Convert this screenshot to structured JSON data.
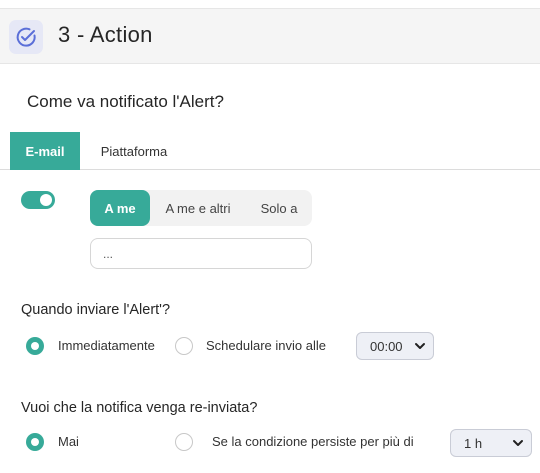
{
  "header": {
    "title": "3 - Action",
    "icon": "check-circle-icon"
  },
  "question": "Come va notificato l'Alert?",
  "tabs": [
    {
      "label": "E-mail",
      "active": true
    },
    {
      "label": "Piattaforma",
      "active": false
    }
  ],
  "email_toggle": {
    "on": true
  },
  "recipients": {
    "options": [
      "A me",
      "A me e altri",
      "Solo a"
    ],
    "selected": "A me"
  },
  "email_input": {
    "placeholder": "..."
  },
  "when_section": {
    "label": "Quando inviare l'Alert'?",
    "options": [
      {
        "label": "Immediatamente",
        "checked": true
      },
      {
        "label": "Schedulare invio alle",
        "checked": false
      }
    ],
    "time_select": {
      "value": "00:00"
    }
  },
  "resend_section": {
    "label": "Vuoi che la notifica venga re-inviata?",
    "options": [
      {
        "label": "Mai",
        "checked": true
      },
      {
        "label": "Se la condizione persiste per più di",
        "checked": false
      }
    ],
    "interval_select": {
      "value": "1 h"
    }
  },
  "colors": {
    "accent": "#37aa99",
    "header_bg": "#f5f5f5",
    "icon_bg": "#e6e8f6",
    "icon_stroke": "#5b6fd8"
  }
}
